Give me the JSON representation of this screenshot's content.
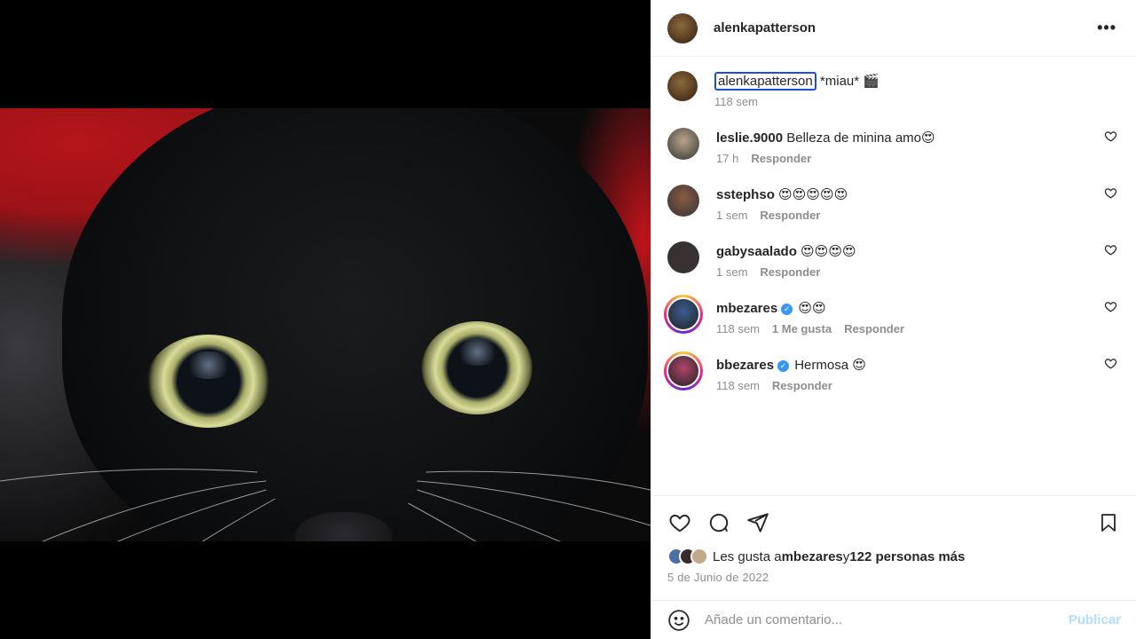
{
  "post": {
    "author": "alenkapatterson",
    "more_icon": "more-horizontal-icon",
    "caption_text": "*miau* 🎬",
    "caption_time": "118 sem"
  },
  "comments": [
    {
      "user": "leslie.9000",
      "verified": false,
      "text": "Belleza de minina amo😍",
      "time": "17 h",
      "likes": "",
      "reply": "Responder",
      "avatar_color": "#b8a58a",
      "ring": false
    },
    {
      "user": "sstephso",
      "verified": false,
      "text": "😍😍😍😍😍",
      "time": "1 sem",
      "likes": "",
      "reply": "Responder",
      "avatar_color": "#8a5a45",
      "ring": false
    },
    {
      "user": "gabysaalado",
      "verified": false,
      "text": "😍😍😍😍",
      "time": "1 sem",
      "likes": "",
      "reply": "Responder",
      "avatar_color": "#3a3030",
      "ring": false
    },
    {
      "user": "mbezares",
      "verified": true,
      "text": "😍😍",
      "time": "118 sem",
      "likes": "1 Me gusta",
      "reply": "Responder",
      "avatar_color": "#3b5c8f",
      "ring": true
    },
    {
      "user": "bbezares",
      "verified": true,
      "text": "Hermosa 😍",
      "time": "118 sem",
      "likes": "",
      "reply": "Responder",
      "avatar_color": "#b0456a",
      "ring": true
    }
  ],
  "actions": {
    "like_icon": "heart-icon",
    "comment_icon": "comment-icon",
    "share_icon": "send-icon",
    "save_icon": "bookmark-icon"
  },
  "likes": {
    "prefix": "Les gusta a ",
    "user": "mbezares",
    "connector": " y ",
    "others": "122 personas más"
  },
  "date": "5 de Junio de 2022",
  "add_comment": {
    "emoji_icon": "smiley-icon",
    "placeholder": "Añade un comentario...",
    "publish_label": "Publicar"
  },
  "colors": {
    "accent_blue": "#3897f0",
    "publish_disabled": "#b2dffc",
    "muted_text": "#8e8e8e"
  }
}
